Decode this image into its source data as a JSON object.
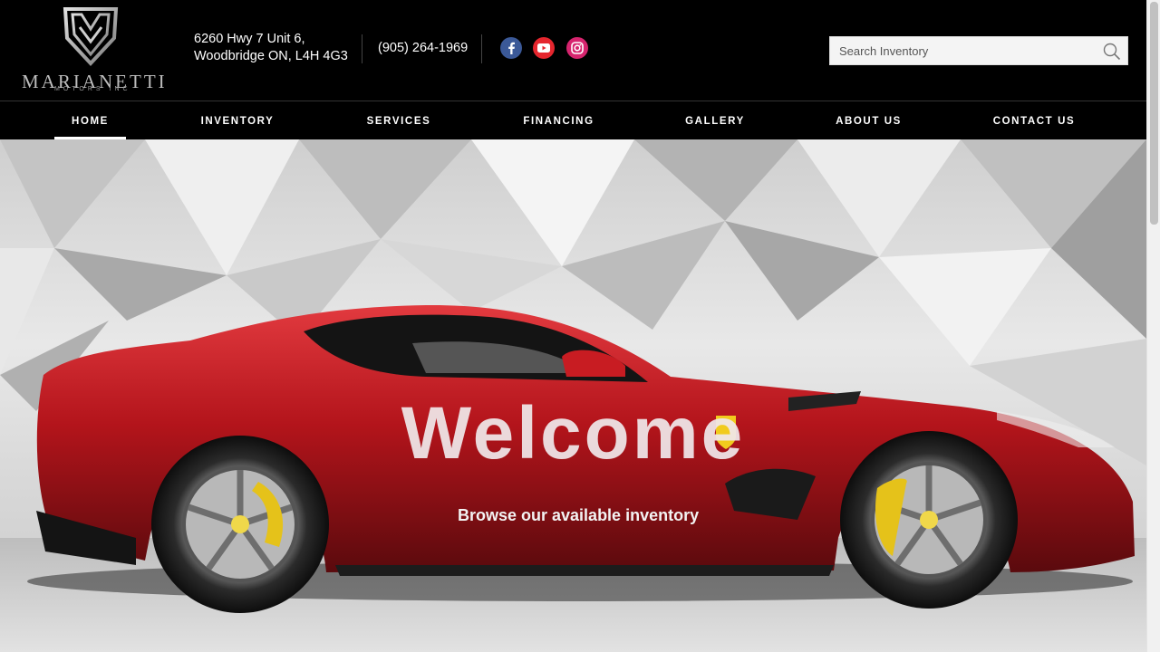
{
  "brand": {
    "name": "MARIANETTI",
    "tagline": "MOTORS INC"
  },
  "header": {
    "address_line1": "6260 Hwy 7 Unit 6,",
    "address_line2": "Woodbridge ON, L4H 4G3",
    "phone": "(905) 264-1969",
    "social": [
      {
        "name": "facebook",
        "icon": "facebook-icon",
        "color": "#3b5998"
      },
      {
        "name": "youtube",
        "icon": "youtube-icon",
        "color": "#e5262e"
      },
      {
        "name": "instagram",
        "icon": "instagram-icon",
        "color": "#d6246e"
      }
    ],
    "search": {
      "placeholder": "Search Inventory",
      "value": "",
      "icon": "search-icon"
    }
  },
  "nav": {
    "items": [
      {
        "label": "HOME",
        "active": true
      },
      {
        "label": "INVENTORY",
        "active": false
      },
      {
        "label": "SERVICES",
        "active": false
      },
      {
        "label": "FINANCING",
        "active": false
      },
      {
        "label": "GALLERY",
        "active": false
      },
      {
        "label": "ABOUT US",
        "active": false
      },
      {
        "label": "CONTACT US",
        "active": false
      }
    ]
  },
  "hero": {
    "title": "Welcome",
    "cta": "Browse our available inventory",
    "image": "red-sports-car-photo"
  },
  "colors": {
    "accent": "#c8141b",
    "background": "#000000",
    "text": "#ffffff"
  }
}
